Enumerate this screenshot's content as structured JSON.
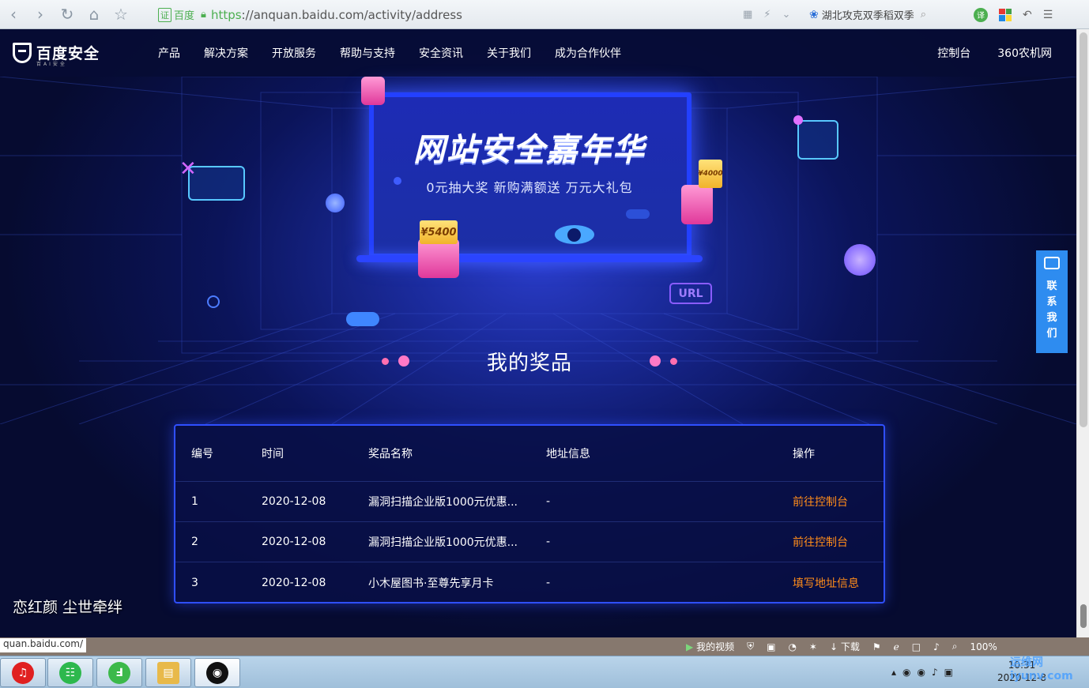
{
  "browser": {
    "cert_badge": "证",
    "cert_name": "百度",
    "url_proto": "https",
    "url_rest": "://anquan.baidu.com/activity/address",
    "search_text": "湖北攻克双季稻双季",
    "translate_label": "译",
    "zoom": "100%"
  },
  "site": {
    "logo_name": "百度安全",
    "logo_tag": "百AI安全",
    "nav": [
      "产品",
      "解决方案",
      "开放服务",
      "帮助与支持",
      "安全资讯",
      "关于我们",
      "成为合作伙伴"
    ],
    "nav_right": [
      "控制台",
      "360农机网"
    ]
  },
  "hero": {
    "title": "网站安全嘉年华",
    "subtitle": "0元抽大奖 新购满额送 万元大礼包",
    "ticket_left": "¥5400",
    "ticket_right": "¥4000",
    "url_tag": "URL",
    "prize_heading": "我的奖品"
  },
  "contact": {
    "chars": [
      "联",
      "系",
      "我",
      "们"
    ]
  },
  "table": {
    "headers": [
      "编号",
      "时间",
      "奖品名称",
      "地址信息",
      "操作"
    ],
    "rows": [
      {
        "id": "1",
        "date": "2020-12-08",
        "prize": "漏洞扫描企业版1000元优惠...",
        "address": "-",
        "action": "前往控制台"
      },
      {
        "id": "2",
        "date": "2020-12-08",
        "prize": "漏洞扫描企业版1000元优惠...",
        "address": "-",
        "action": "前往控制台"
      },
      {
        "id": "3",
        "date": "2020-12-08",
        "prize": "小木屋图书·至尊先享月卡",
        "address": "-",
        "action": "填写地址信息"
      }
    ]
  },
  "overlay": {
    "lyric": "恋红颜 尘世牵绊",
    "status_url": "quan.baidu.com/",
    "status_video": "我的视频",
    "status_download": "下载"
  },
  "taskbar": {
    "clock_time": "10:31",
    "clock_date": "2020-12-8",
    "watermark": "运维网 iyunv.com"
  },
  "colors": {
    "accent_blue": "#2f4fff",
    "action_orange": "#ff8c1a",
    "contact_blue": "#2e8cf0"
  }
}
